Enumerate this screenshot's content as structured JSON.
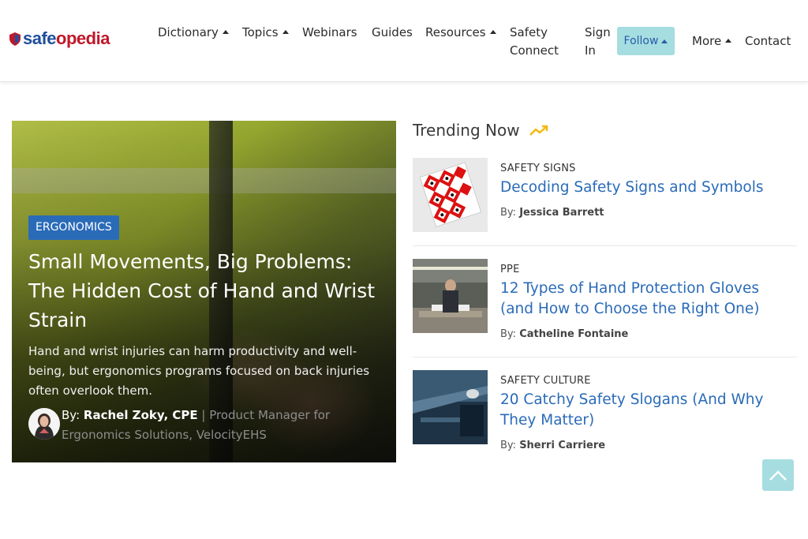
{
  "header": {
    "logo": {
      "part1": "safe",
      "part2": "opedia"
    },
    "nav": {
      "dictionary": "Dictionary",
      "topics": "Topics",
      "webinars": "Webinars",
      "guides": "Guides",
      "resources": "Resources",
      "safety_connect_1": "Safety",
      "safety_connect_2": "Connect",
      "sign_in_1": "Sign",
      "sign_in_2": "In",
      "follow": "Follow",
      "more": "More",
      "contact": "Contact"
    }
  },
  "hero": {
    "tag": "ERGONOMICS",
    "title": "Small Movements, Big Problems: The Hidden Cost of Hand and Wrist Strain",
    "description": "Hand and wrist injuries can harm productivity and well-being, but ergonomics programs focused on back injuries often overlook them.",
    "author_prefix": "By: ",
    "author_name": "Rachel Zoky, CPE",
    "separator": " | ",
    "author_role": "Product Manager for Ergonomics Solutions, VelocityEHS"
  },
  "trending": {
    "title": "Trending Now",
    "items": [
      {
        "category": "SAFETY SIGNS",
        "title": "Decoding Safety Signs and Symbols",
        "by": "By: ",
        "author": "Jessica Barrett"
      },
      {
        "category": "PPE",
        "title": "12 Types of Hand Protection Gloves (and How to Choose the Right One)",
        "by": "By: ",
        "author": "Catheline Fontaine"
      },
      {
        "category": "SAFETY CULTURE",
        "title": "20 Catchy Safety Slogans (And Why They Matter)",
        "by": "By: ",
        "author": "Sherri Carriere"
      }
    ]
  },
  "colors": {
    "brand_blue": "#1f4e9c",
    "brand_red": "#c0182a",
    "link_blue": "#2a6bb8",
    "follow_bg": "#a6dde0",
    "trend_icon": "#f5b80f"
  }
}
